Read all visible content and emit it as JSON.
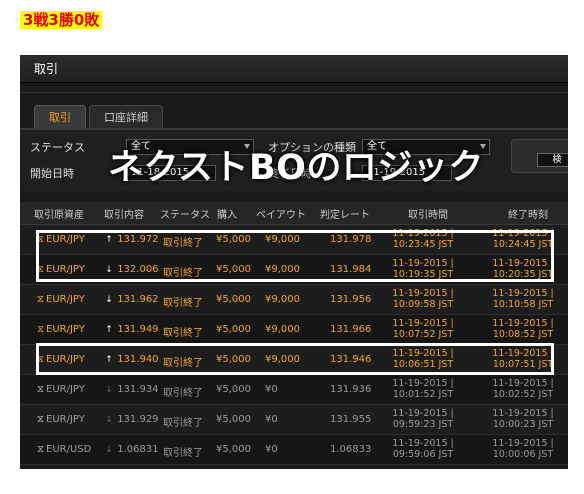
{
  "blog_title": "3戦3勝0敗",
  "panel": {
    "header": "取引",
    "tabs": [
      {
        "label": "取引",
        "active": true
      },
      {
        "label": "口座詳細",
        "active": false
      }
    ]
  },
  "filters": {
    "status_label": "ステータス",
    "status_value": "全て",
    "option_type_label": "オプションの種類",
    "option_type_value": "全て",
    "start_date_label": "開始日時",
    "start_date_value": "11-18-2015",
    "end_date_label": "終了日時",
    "end_date_value": "11-19-2015",
    "side_button_label": "検"
  },
  "overlay_text": "ネクストBOのロジック",
  "columns": [
    "取引原資産",
    "取引内容",
    "ステータス",
    "購入",
    "ペイアウト",
    "判定レート",
    "取引時間",
    "終了時刻"
  ],
  "trades": [
    {
      "asset": "EUR/JPY",
      "direction": "up",
      "rate": "131.972",
      "status": "取引終了",
      "purchase": "¥5,000",
      "payout": "¥9,000",
      "judge_rate": "131.978",
      "trade_time": [
        "11-19-2015 |",
        "10:23:45 JST"
      ],
      "end_time": [
        "11-19-2015 |",
        "10:24:45 JST"
      ],
      "style": "gold"
    },
    {
      "asset": "EUR/JPY",
      "direction": "down",
      "rate": "132.006",
      "status": "取引終了",
      "purchase": "¥5,000",
      "payout": "¥9,000",
      "judge_rate": "131.984",
      "trade_time": [
        "11-19-2015 |",
        "10:19:35 JST"
      ],
      "end_time": [
        "11-19-2015 |",
        "10:20:35 JST"
      ],
      "style": "gold"
    },
    {
      "asset": "EUR/JPY",
      "direction": "down",
      "rate": "131.962",
      "status": "取引終了",
      "purchase": "¥5,000",
      "payout": "¥9,000",
      "judge_rate": "131.956",
      "trade_time": [
        "11-19-2015 |",
        "10:09:58 JST"
      ],
      "end_time": [
        "11-19-2015 |",
        "10:10:58 JST"
      ],
      "style": "gold"
    },
    {
      "asset": "EUR/JPY",
      "direction": "up",
      "rate": "131.949",
      "status": "取引終了",
      "purchase": "¥5,000",
      "payout": "¥9,000",
      "judge_rate": "131.966",
      "trade_time": [
        "11-19-2015 |",
        "10:07:52 JST"
      ],
      "end_time": [
        "11-19-2015 |",
        "10:08:52 JST"
      ],
      "style": "gold"
    },
    {
      "asset": "EUR/JPY",
      "direction": "up",
      "rate": "131.940",
      "status": "取引終了",
      "purchase": "¥5,000",
      "payout": "¥9,000",
      "judge_rate": "131.946",
      "trade_time": [
        "11-19-2015 |",
        "10:06:51 JST"
      ],
      "end_time": [
        "11-19-2015 |",
        "10:07:51 JST"
      ],
      "style": "gold"
    },
    {
      "asset": "EUR/JPY",
      "direction": "none",
      "rate": "131.934",
      "status": "取引終了",
      "purchase": "¥5,000",
      "payout": "¥0",
      "judge_rate": "131.936",
      "trade_time": [
        "11-19-2015 |",
        "10:01:52 JST"
      ],
      "end_time": [
        "11-19-2015 |",
        "10:02:52 JST"
      ],
      "style": "gray"
    },
    {
      "asset": "EUR/JPY",
      "direction": "none",
      "rate": "131.929",
      "status": "取引終了",
      "purchase": "¥5,000",
      "payout": "¥0",
      "judge_rate": "131.955",
      "trade_time": [
        "11-19-2015 |",
        "09:59:23 JST"
      ],
      "end_time": [
        "11-19-2015 |",
        "10:00:23 JST"
      ],
      "style": "gray"
    },
    {
      "asset": "EUR/USD",
      "direction": "none",
      "rate": "1.06831",
      "status": "取引終了",
      "purchase": "¥5,000",
      "payout": "¥0",
      "judge_rate": "1.06833",
      "trade_time": [
        "11-19-2015 |",
        "09:59:06 JST"
      ],
      "end_time": [
        "11-19-2015 |",
        "10:00:06 JST"
      ],
      "style": "gray"
    }
  ],
  "colors": {
    "accent": "#f5a623",
    "highlight_box": "#ffffff",
    "title_bg": "#ffff00",
    "title_text": "#e8000a"
  }
}
